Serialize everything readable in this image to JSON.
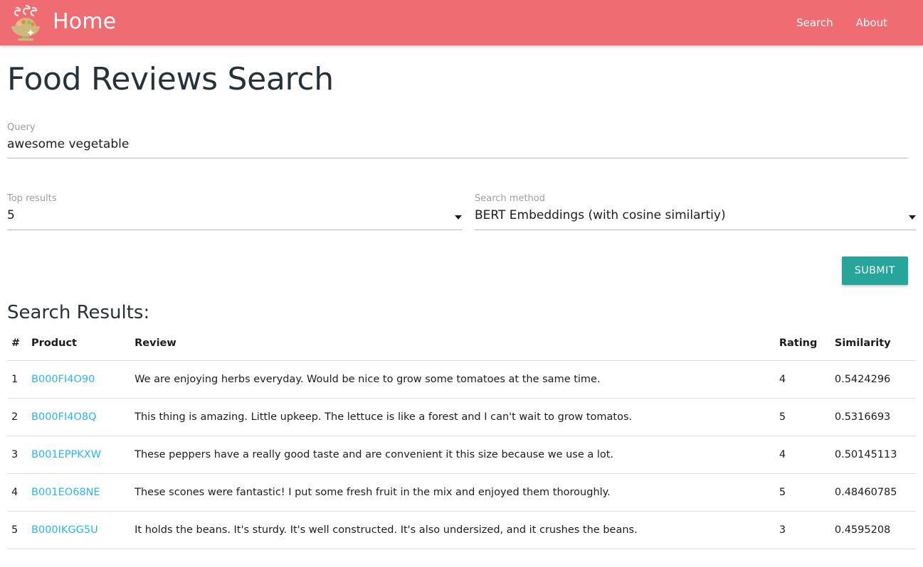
{
  "navbar": {
    "logo_icon": "food-bowl-icon",
    "brand_title": "Home",
    "links": [
      {
        "label": "Search"
      },
      {
        "label": "About"
      }
    ],
    "background_color": "#ef6c72"
  },
  "page": {
    "title": "Food Reviews Search"
  },
  "form": {
    "query": {
      "label": "Query",
      "value": "awesome vegetable",
      "placeholder": ""
    },
    "top_results": {
      "label": "Top results",
      "value": "5",
      "dropdown_icon": "chevron-down-icon"
    },
    "search_method": {
      "label": "Search method",
      "value": "BERT Embeddings (with cosine similartiy)",
      "dropdown_icon": "chevron-down-icon"
    },
    "submit": {
      "label": "SUBMIT",
      "color": "#26a69a"
    }
  },
  "results": {
    "title": "Search Results:",
    "columns": [
      "#",
      "Product",
      "Review",
      "Rating",
      "Similarity"
    ],
    "link_color": "#29b6f6",
    "rows": [
      {
        "index": "1",
        "product": "B000FI4O90",
        "review": "We are enjoying herbs everyday. Would be nice to grow some tomatoes at the same time.",
        "rating": "4",
        "similarity": "0.5424296"
      },
      {
        "index": "2",
        "product": "B000FI4O8Q",
        "review": "This thing is amazing. Little upkeep. The lettuce is like a forest and I can't wait to grow tomatos.",
        "rating": "5",
        "similarity": "0.5316693"
      },
      {
        "index": "3",
        "product": "B001EPPKXW",
        "review": "These peppers have a really good taste and are convenient it this size because we use a lot.",
        "rating": "4",
        "similarity": "0.50145113"
      },
      {
        "index": "4",
        "product": "B001EO68NE",
        "review": "These scones were fantastic! I put some fresh fruit in the mix and enjoyed them thoroughly.",
        "rating": "5",
        "similarity": "0.48460785"
      },
      {
        "index": "5",
        "product": "B000IKGG5U",
        "review": "It holds the beans. It's sturdy. It's well constructed. It's also undersized, and it crushes the beans.",
        "rating": "3",
        "similarity": "0.4595208"
      }
    ]
  }
}
